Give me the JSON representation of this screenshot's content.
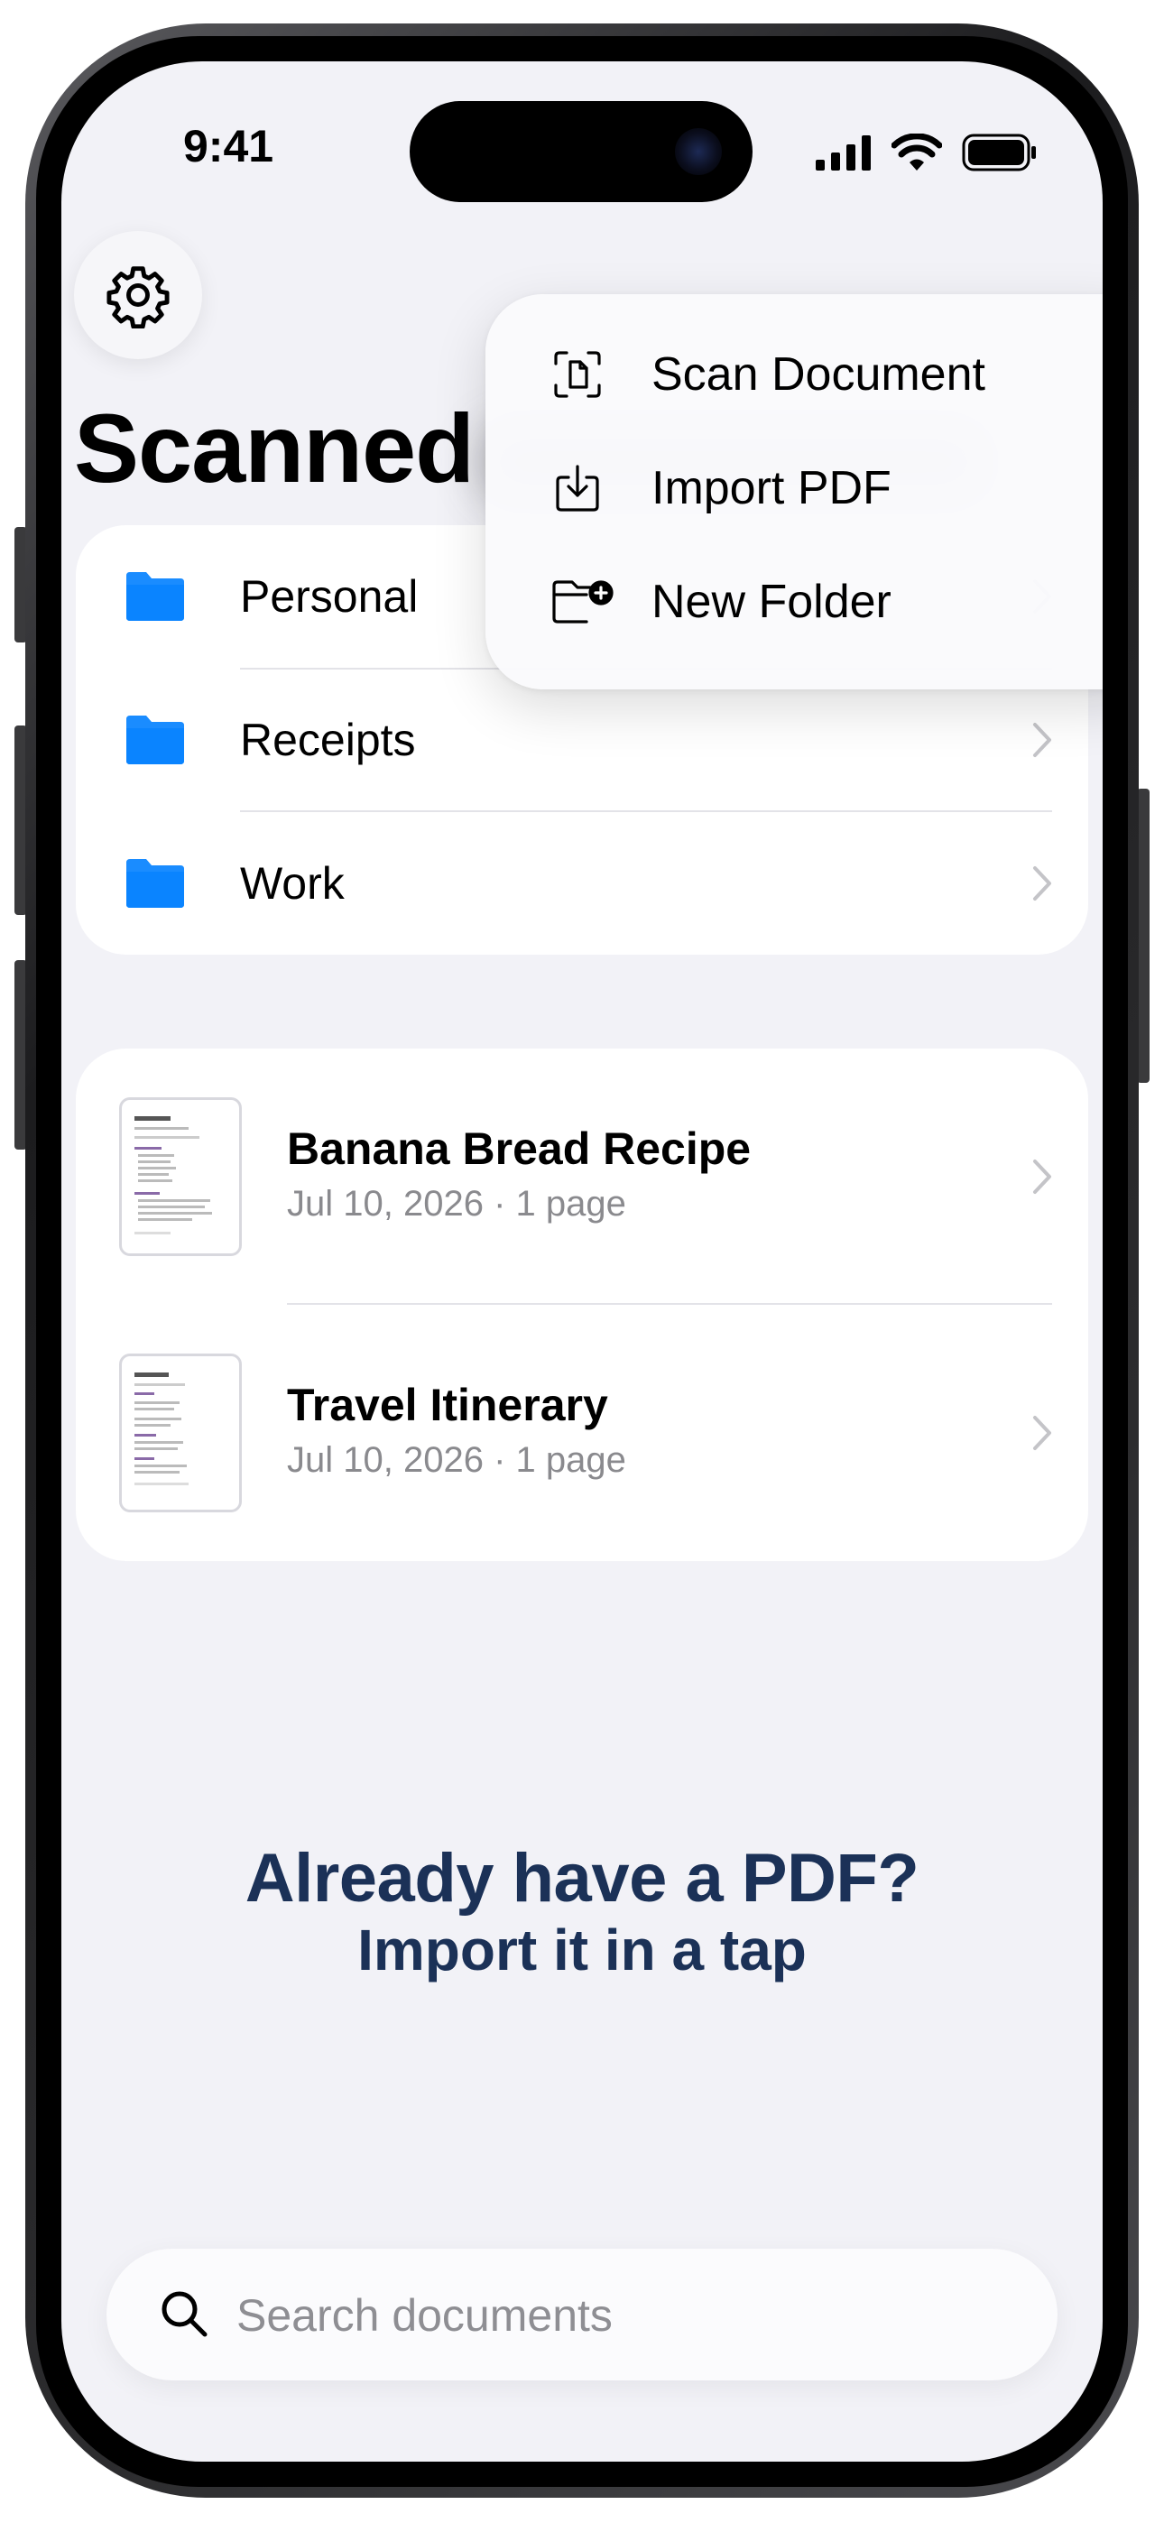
{
  "status_bar": {
    "time": "9:41"
  },
  "header": {
    "title": "Scanned"
  },
  "folders": [
    {
      "label": "Personal"
    },
    {
      "label": "Receipts"
    },
    {
      "label": "Work"
    }
  ],
  "documents": [
    {
      "title": "Banana Bread Recipe",
      "meta": "Jul 10, 2026 · 1 page"
    },
    {
      "title": "Travel Itinerary",
      "meta": "Jul 10, 2026 · 1 page"
    }
  ],
  "promo": {
    "line1": "Already have a PDF?",
    "line2": "Import it in a tap"
  },
  "search": {
    "placeholder": "Search documents"
  },
  "menu": {
    "items": [
      {
        "label": "Scan Document",
        "icon": "scan-document-icon"
      },
      {
        "label": "Import PDF",
        "icon": "import-icon"
      },
      {
        "label": "New Folder",
        "icon": "new-folder-icon"
      }
    ]
  },
  "colors": {
    "accent": "#0a84ff",
    "promo": "#1b3157",
    "background": "#f2f2f7"
  }
}
